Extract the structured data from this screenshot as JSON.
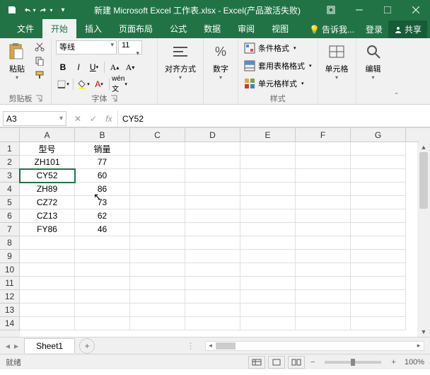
{
  "titlebar": {
    "title": "新建 Microsoft Excel 工作表.xlsx - Excel(产品激活失败)"
  },
  "tabs": {
    "file": "文件",
    "home": "开始",
    "insert": "插入",
    "pagelayout": "页面布局",
    "formulas": "公式",
    "data": "数据",
    "review": "审阅",
    "view": "视图",
    "tellme": "告诉我...",
    "login": "登录",
    "share": "共享"
  },
  "ribbon": {
    "clipboard": {
      "label": "剪贴板",
      "paste": "粘贴"
    },
    "font": {
      "label": "字体",
      "name": "等线",
      "size": "11"
    },
    "alignment": {
      "label": "对齐方式"
    },
    "number": {
      "label": "数字"
    },
    "styles": {
      "label": "样式",
      "cond": "条件格式",
      "table": "套用表格格式",
      "cell": "单元格样式"
    },
    "cells": {
      "label": "单元格"
    },
    "editing": {
      "label": "编辑"
    }
  },
  "formula_bar": {
    "name_box": "A3",
    "formula": "CY52"
  },
  "columns": [
    "A",
    "B",
    "C",
    "D",
    "E",
    "F",
    "G"
  ],
  "rows": [
    "1",
    "2",
    "3",
    "4",
    "5",
    "6",
    "7",
    "8",
    "9",
    "10",
    "11",
    "12",
    "13",
    "14"
  ],
  "grid": [
    [
      "型号",
      "销量",
      "",
      "",
      "",
      "",
      ""
    ],
    [
      "ZH101",
      "77",
      "",
      "",
      "",
      "",
      ""
    ],
    [
      "CY52",
      "60",
      "",
      "",
      "",
      "",
      ""
    ],
    [
      "ZH89",
      "86",
      "",
      "",
      "",
      "",
      ""
    ],
    [
      "CZ72",
      "73",
      "",
      "",
      "",
      "",
      ""
    ],
    [
      "CZ13",
      "62",
      "",
      "",
      "",
      "",
      ""
    ],
    [
      "FY86",
      "46",
      "",
      "",
      "",
      "",
      ""
    ],
    [
      "",
      "",
      "",
      "",
      "",
      "",
      ""
    ],
    [
      "",
      "",
      "",
      "",
      "",
      "",
      ""
    ],
    [
      "",
      "",
      "",
      "",
      "",
      "",
      ""
    ],
    [
      "",
      "",
      "",
      "",
      "",
      "",
      ""
    ],
    [
      "",
      "",
      "",
      "",
      "",
      "",
      ""
    ],
    [
      "",
      "",
      "",
      "",
      "",
      "",
      ""
    ],
    [
      "",
      "",
      "",
      "",
      "",
      "",
      ""
    ]
  ],
  "selected_cell": "A3",
  "sheet": {
    "name": "Sheet1"
  },
  "status": {
    "ready": "就绪",
    "zoom": "100%"
  }
}
